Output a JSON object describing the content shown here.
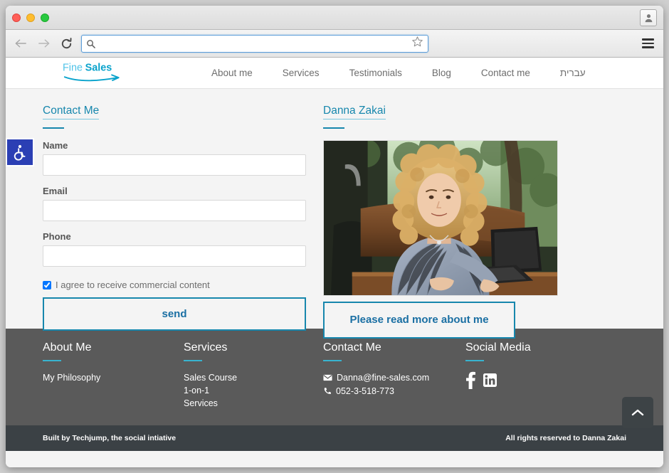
{
  "browser": {
    "traffic_lights": [
      "close",
      "minimize",
      "zoom"
    ],
    "back_label": "Back",
    "forward_label": "Forward",
    "reload_label": "Reload",
    "address_value": "",
    "address_placeholder": "",
    "bookmark_label": "Bookmark this page",
    "profile_label": "Profile",
    "menu_label": "Customize and control"
  },
  "site": {
    "logo": {
      "part1": "Fine",
      "part2": "Sales"
    },
    "nav": [
      {
        "label": "About me"
      },
      {
        "label": "Services"
      },
      {
        "label": "Testimonials"
      },
      {
        "label": "Blog"
      },
      {
        "label": "Contact me"
      },
      {
        "label": "עברית",
        "rtl": true
      }
    ]
  },
  "contact_form": {
    "title": "Contact Me",
    "fields": [
      {
        "label": "Name",
        "value": "",
        "placeholder": ""
      },
      {
        "label": "Email",
        "value": "",
        "placeholder": ""
      },
      {
        "label": "Phone",
        "value": "",
        "placeholder": ""
      }
    ],
    "consent_label": "I agree to receive commercial content",
    "consent_checked": true,
    "submit_label": "send"
  },
  "profile": {
    "title": "Danna Zakai",
    "photo_alt": "Danna Zakai smiling at a wooden desk with a laptop",
    "read_more_label": "Please read more about me"
  },
  "footer": {
    "columns": [
      {
        "heading": "About Me",
        "links": [
          "My Philosophy"
        ]
      },
      {
        "heading": "Services",
        "links": [
          "Sales Course",
          "1-on-1",
          "Services"
        ]
      },
      {
        "heading": "Contact Me",
        "email": "Danna@fine-sales.com",
        "phone": "052-3-518-773"
      },
      {
        "heading": "Social Media",
        "social": [
          "facebook",
          "linkedin"
        ]
      }
    ],
    "built_by": "Built by Techjump, the social intiative",
    "rights": "All rights reserved to Danna Zakai"
  },
  "widgets": {
    "accessibility_label": "Accessibility options",
    "scroll_top_label": "Scroll to top"
  },
  "colors": {
    "accent_teal": "#1787ad",
    "accent_cyan": "#38b3cf",
    "footer_gray": "#5a5a5a",
    "bottombar_dark": "#3b4145",
    "page_bg": "#f4f4f4",
    "a11y_blue": "#2b3fb4"
  }
}
